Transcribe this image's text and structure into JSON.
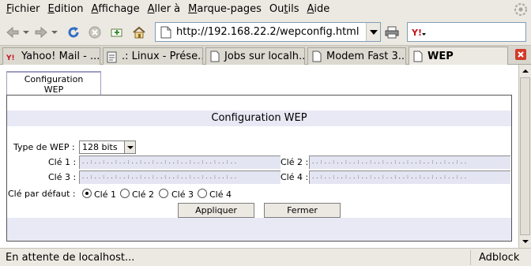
{
  "menu": [
    {
      "label": "Fichier",
      "accel": "F",
      "rest": "ichier"
    },
    {
      "label": "Edition",
      "accel": "E",
      "rest": "dition"
    },
    {
      "label": "Affichage",
      "accel": "A",
      "rest": "ffichage"
    },
    {
      "label": "Aller à",
      "accel": "A",
      "rest": "ller à"
    },
    {
      "label": "Marque-pages",
      "accel": "M",
      "rest": "arque-pages"
    },
    {
      "label": "Outils",
      "accel": "O",
      "rest": "utils"
    },
    {
      "label": "Aide",
      "accel": "A",
      "rest": "ide"
    }
  ],
  "navbar": {
    "url": "http://192.168.22.2/wepconfig.html",
    "icons": [
      "back-icon",
      "forward-icon",
      "reload-icon",
      "stop-icon",
      "new-tab-icon",
      "home-icon",
      "print-icon",
      "yahoo-search-icon"
    ]
  },
  "tabs": [
    {
      "title": "Yahoo! Mail - ...",
      "icon": "yahoo-icon"
    },
    {
      "title": ".: Linux - Prése...",
      "icon": "notepad-icon"
    },
    {
      "title": "Jobs sur localh...",
      "icon": "page-icon"
    },
    {
      "title": "Modem Fast 3...",
      "icon": "page-icon"
    },
    {
      "title": "WEP",
      "icon": "page-icon",
      "active": true
    }
  ],
  "page": {
    "tab_label_line1": "Configuration",
    "tab_label_line2": "WEP",
    "header": "Configuration WEP",
    "wep_type_label": "Type de WEP :",
    "wep_type_value": "128 bits",
    "key1_label": "Clé 1 :",
    "key2_label": "Clé 2 :",
    "key3_label": "Clé 3 :",
    "key4_label": "Clé 4 :",
    "key1_value": "..:..:..:..:..:..:..:..:..:..:..:..:..",
    "key2_value": "..:..:..:..:..:..:..:..:..:..:..:..:..",
    "key3_value": "..:..:..:..:..:..:..:..:..:..:..:..:..",
    "key4_value": "..:..:..:..:..:..:..:..:..:..:..:..:..",
    "default_key_label": "Clé par défaut :",
    "radio_labels": [
      "Clé 1",
      "Clé 2",
      "Clé 3",
      "Clé 4"
    ],
    "selected_default": "Clé 1",
    "apply_button": "Appliquer",
    "close_button": "Fermer"
  },
  "status": {
    "text": "En attente de localhost...",
    "adblock": "Adblock"
  },
  "colors": {
    "panel_band": "#e8e9f5",
    "key_field": "#e4e5f2",
    "tab_close": "#d23b2a",
    "yahoo_red": "#c4121a"
  }
}
